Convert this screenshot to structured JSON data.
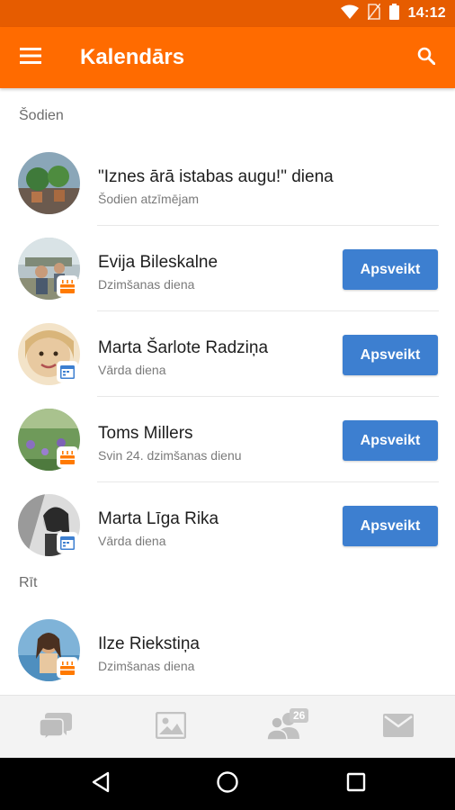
{
  "status_bar": {
    "time": "14:12"
  },
  "app_bar": {
    "title": "Kalendārs"
  },
  "sections": [
    {
      "header": "Šodien"
    },
    {
      "header": "Rīt"
    }
  ],
  "events": [
    {
      "title": "\"Iznes ārā istabas augu!\" diena",
      "subtitle": "Šodien atzīmējam"
    },
    {
      "name": "Evija Bileskalne",
      "subtitle": "Dzimšanas diena",
      "badge": "cake-icon",
      "button": "Apsveikt"
    },
    {
      "name": "Marta Šarlote Radziņa",
      "subtitle": "Vārda diena",
      "badge": "calendar-icon",
      "button": "Apsveikt"
    },
    {
      "name": "Toms Millers",
      "subtitle": "Svin 24. dzimšanas dienu",
      "badge": "cake-icon",
      "button": "Apsveikt"
    },
    {
      "name": "Marta Līga Rika",
      "subtitle": "Vārda diena",
      "badge": "calendar-icon",
      "button": "Apsveikt"
    },
    {
      "name": "Ilze Riekstiņa",
      "subtitle": "Dzimšanas diena",
      "badge": "cake-icon"
    }
  ],
  "bottom_nav": {
    "items": [
      "chat-icon",
      "photos-icon",
      "friends-icon",
      "mail-icon"
    ],
    "friends_count": "26"
  },
  "colors": {
    "status_bar": "#e65c00",
    "app_bar": "#ff6b00",
    "button": "#3d7fd0",
    "cake_badge": "#ff7a00",
    "calendar_badge": "#3d7fd0"
  }
}
